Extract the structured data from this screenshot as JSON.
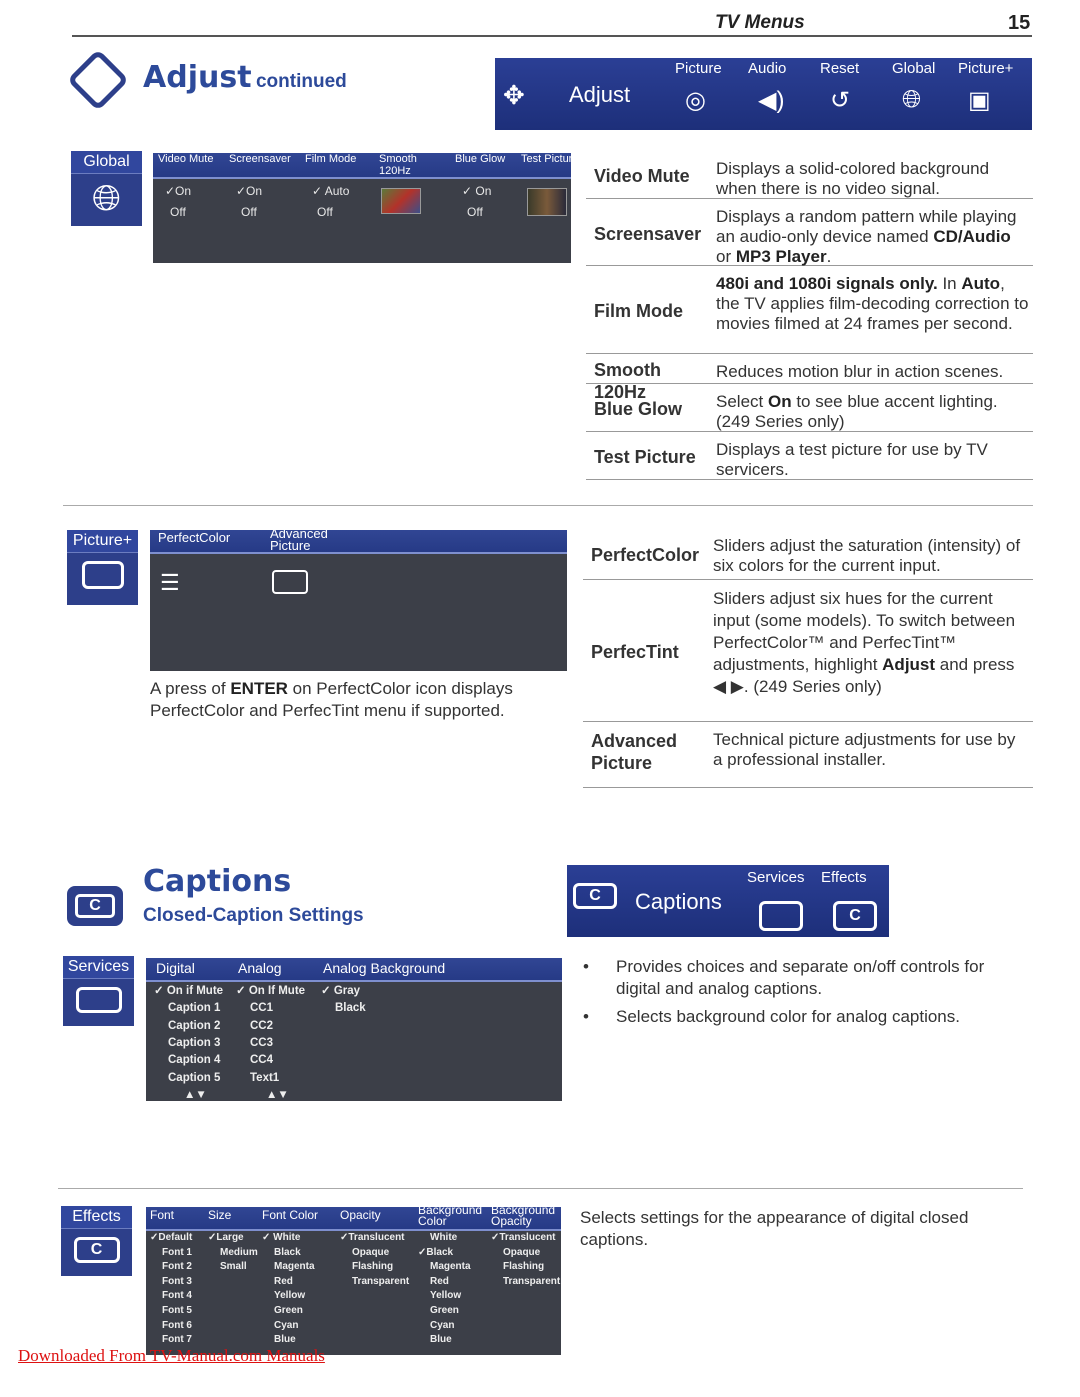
{
  "header": {
    "title": "TV Menus",
    "page": "15"
  },
  "adjust": {
    "title": "Adjust",
    "title_suffix": "continued",
    "menubar": {
      "label": "Adjust",
      "tabs": [
        "Picture",
        "Audio",
        "Reset",
        "Global",
        "Picture+"
      ]
    },
    "global": {
      "side_label": "Global",
      "columns": [
        "Video Mute",
        "Screensaver",
        "Film Mode",
        "Smooth 120Hz",
        "Blue Glow",
        "Test Picture"
      ],
      "values": [
        [
          "✓On",
          "Off"
        ],
        [
          "✓On",
          "Off"
        ],
        [
          "✓ Auto",
          "Off"
        ],
        [],
        [
          "✓ On",
          "Off"
        ],
        []
      ],
      "rows": [
        {
          "label": "Video Mute",
          "desc": [
            {
              "t": "Displays a solid-colored background when there is no video signal."
            }
          ]
        },
        {
          "label": "Screensaver",
          "desc": [
            {
              "t": "Displays a random pattern while playing an audio-only device named "
            },
            {
              "t": "CD/Audio",
              "b": true
            },
            {
              "t": " or "
            },
            {
              "t": "MP3 Player",
              "b": true
            },
            {
              "t": "."
            }
          ]
        },
        {
          "label": "Film Mode",
          "desc": [
            {
              "t": "480i and 1080i signals only.",
              "b": true
            },
            {
              "t": " In "
            },
            {
              "t": "Auto",
              "b": true
            },
            {
              "t": ", the TV applies film-decoding correction to movies filmed at 24 frames per second."
            }
          ]
        },
        {
          "label": "Smooth 120Hz",
          "desc": [
            {
              "t": "Reduces motion blur in action scenes."
            }
          ]
        },
        {
          "label": "Blue Glow",
          "desc": [
            {
              "t": "Select "
            },
            {
              "t": "On",
              "b": true
            },
            {
              "t": " to see blue accent lighting. (249 Series only)"
            }
          ]
        },
        {
          "label": "Test Picture",
          "desc": [
            {
              "t": "Displays a test picture for use by TV servicers."
            }
          ]
        }
      ]
    },
    "pictureplus": {
      "side_label": "Picture+",
      "columns": [
        "PerfectColor",
        "Advanced Picture"
      ],
      "caption": [
        {
          "t": "A press of "
        },
        {
          "t": "ENTER",
          "b": true
        },
        {
          "t": " on PerfectColor icon displays PerfectColor and PerfecTint menu if supported."
        }
      ],
      "rows": [
        {
          "label": "PerfectColor",
          "desc": [
            {
              "t": "Sliders adjust the saturation (intensity) of six colors for the current input."
            }
          ]
        },
        {
          "label": "PerfecTint",
          "desc": [
            {
              "t": "Sliders adjust six hues for the current input (some models). To switch between PerfectColor™ and PerfecTint™ adjustments, highlight "
            },
            {
              "t": "Adjust",
              "b": true
            },
            {
              "t": " and press ◀ ▶. (249 Series only)"
            }
          ]
        },
        {
          "label": "Advanced Picture",
          "desc": [
            {
              "t": "Technical picture adjustments for use by a professional installer."
            }
          ]
        }
      ]
    }
  },
  "captions": {
    "title": "Captions",
    "subtitle": "Closed-Caption Settings",
    "menubar": {
      "label": "Captions",
      "tabs": [
        "Services",
        "Effects"
      ]
    },
    "services": {
      "side_label": "Services",
      "columns": [
        "Digital",
        "Analog",
        "Analog Background"
      ],
      "values": [
        [
          "✓ On if Mute",
          "Caption 1",
          "Caption 2",
          "Caption 3",
          "Caption 4",
          "Caption 5",
          "▲▼"
        ],
        [
          "✓ On If Mute",
          "CC1",
          "CC2",
          "CC3",
          "CC4",
          "Text1",
          "▲▼"
        ],
        [
          "✓ Gray",
          "Black"
        ]
      ],
      "bullets": [
        "Provides choices and separate on/off controls for digital and analog captions.",
        "Selects background color for analog captions."
      ]
    },
    "effects": {
      "side_label": "Effects",
      "columns": [
        "Font",
        "Size",
        "Font Color",
        "Opacity",
        "Background Color",
        "Background Opacity"
      ],
      "values": [
        [
          "✓Default",
          "Font 1",
          "Font 2",
          "Font 3",
          "Font 4",
          "Font 5",
          "Font 6",
          "Font 7"
        ],
        [
          "✓Large",
          "Medium",
          "Small"
        ],
        [
          "✓ White",
          "Black",
          "Magenta",
          "Red",
          "Yellow",
          "Green",
          "Cyan",
          "Blue"
        ],
        [
          "✓Translucent",
          "Opaque",
          "Flashing",
          "Transparent"
        ],
        [
          "White",
          "✓Black",
          "Magenta",
          "Red",
          "Yellow",
          "Green",
          "Cyan",
          "Blue"
        ],
        [
          "✓Translucent",
          "Opaque",
          "Flashing",
          "Transparent"
        ]
      ],
      "desc": "Selects settings for the appearance of digital closed captions."
    }
  },
  "footer": {
    "link": "Downloaded From TV-Manual.com Manuals"
  },
  "colors": {
    "accent": "#2d4a9a",
    "menu": "#2b3f95",
    "panel": "#3c3f48",
    "link": "#dd1111"
  }
}
